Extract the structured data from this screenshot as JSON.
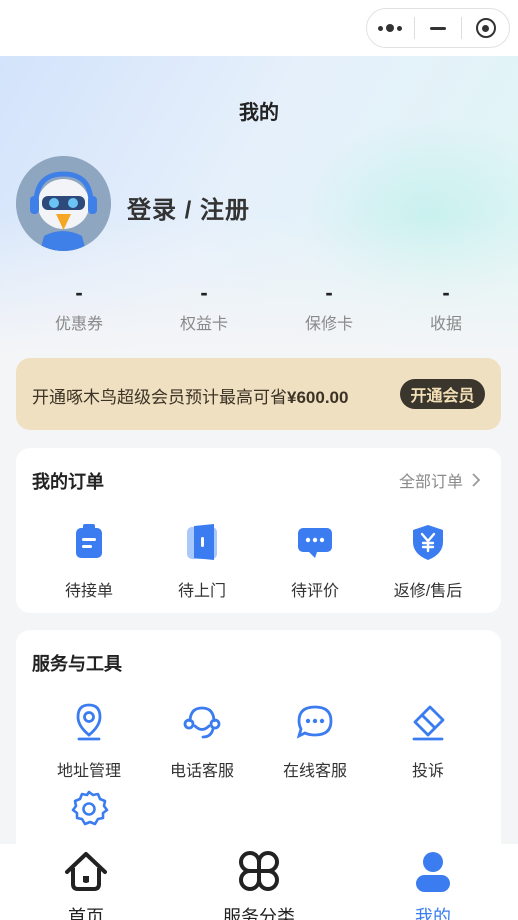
{
  "page_title": "我的",
  "user": {
    "login_label": "登录 / 注册"
  },
  "stats": [
    {
      "value": "-",
      "label": "优惠券"
    },
    {
      "value": "-",
      "label": "权益卡"
    },
    {
      "value": "-",
      "label": "保修卡"
    },
    {
      "value": "-",
      "label": "收据"
    }
  ],
  "vip": {
    "text_prefix": "开通啄木鸟超级会员预计最高可省",
    "amount": "¥600.00",
    "button_label": "开通会员"
  },
  "orders": {
    "title": "我的订单",
    "all_label": "全部订单",
    "items": [
      {
        "label": "待接单",
        "icon": "clipboard-icon"
      },
      {
        "label": "待上门",
        "icon": "door-icon"
      },
      {
        "label": "待评价",
        "icon": "chat-icon"
      },
      {
        "label": "返修/售后",
        "icon": "shield-yen-icon"
      }
    ]
  },
  "tools": {
    "title": "服务与工具",
    "items": [
      {
        "label": "地址管理",
        "icon": "location-pin-icon"
      },
      {
        "label": "电话客服",
        "icon": "headset-icon"
      },
      {
        "label": "在线客服",
        "icon": "chat-bubble-icon"
      },
      {
        "label": "投诉",
        "icon": "eraser-icon"
      },
      {
        "label": "设置",
        "icon": "gear-icon"
      }
    ]
  },
  "tabbar": [
    {
      "label": "首页",
      "icon": "home-icon",
      "active": false
    },
    {
      "label": "服务分类",
      "icon": "category-icon",
      "active": false
    },
    {
      "label": "我的",
      "icon": "profile-icon",
      "active": true
    }
  ],
  "colors": {
    "accent": "#3b7cf0",
    "vip_bg": "#efe0c2",
    "vip_button": "#3a352d"
  }
}
